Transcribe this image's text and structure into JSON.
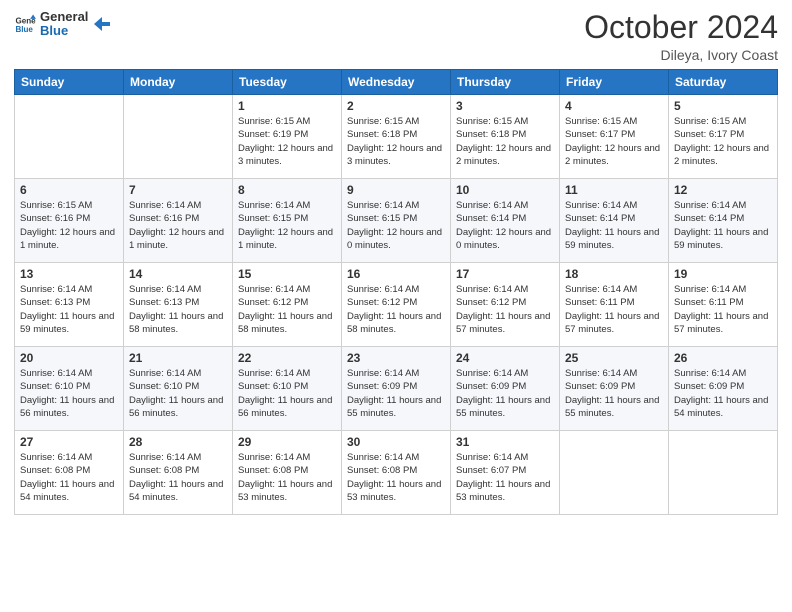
{
  "logo": {
    "line1": "General",
    "line2": "Blue"
  },
  "title": "October 2024",
  "subtitle": "Dileya, Ivory Coast",
  "days_header": [
    "Sunday",
    "Monday",
    "Tuesday",
    "Wednesday",
    "Thursday",
    "Friday",
    "Saturday"
  ],
  "weeks": [
    [
      {
        "day": "",
        "info": ""
      },
      {
        "day": "",
        "info": ""
      },
      {
        "day": "1",
        "info": "Sunrise: 6:15 AM\nSunset: 6:19 PM\nDaylight: 12 hours and 3 minutes."
      },
      {
        "day": "2",
        "info": "Sunrise: 6:15 AM\nSunset: 6:18 PM\nDaylight: 12 hours and 3 minutes."
      },
      {
        "day": "3",
        "info": "Sunrise: 6:15 AM\nSunset: 6:18 PM\nDaylight: 12 hours and 2 minutes."
      },
      {
        "day": "4",
        "info": "Sunrise: 6:15 AM\nSunset: 6:17 PM\nDaylight: 12 hours and 2 minutes."
      },
      {
        "day": "5",
        "info": "Sunrise: 6:15 AM\nSunset: 6:17 PM\nDaylight: 12 hours and 2 minutes."
      }
    ],
    [
      {
        "day": "6",
        "info": "Sunrise: 6:15 AM\nSunset: 6:16 PM\nDaylight: 12 hours and 1 minute."
      },
      {
        "day": "7",
        "info": "Sunrise: 6:14 AM\nSunset: 6:16 PM\nDaylight: 12 hours and 1 minute."
      },
      {
        "day": "8",
        "info": "Sunrise: 6:14 AM\nSunset: 6:15 PM\nDaylight: 12 hours and 1 minute."
      },
      {
        "day": "9",
        "info": "Sunrise: 6:14 AM\nSunset: 6:15 PM\nDaylight: 12 hours and 0 minutes."
      },
      {
        "day": "10",
        "info": "Sunrise: 6:14 AM\nSunset: 6:14 PM\nDaylight: 12 hours and 0 minutes."
      },
      {
        "day": "11",
        "info": "Sunrise: 6:14 AM\nSunset: 6:14 PM\nDaylight: 11 hours and 59 minutes."
      },
      {
        "day": "12",
        "info": "Sunrise: 6:14 AM\nSunset: 6:14 PM\nDaylight: 11 hours and 59 minutes."
      }
    ],
    [
      {
        "day": "13",
        "info": "Sunrise: 6:14 AM\nSunset: 6:13 PM\nDaylight: 11 hours and 59 minutes."
      },
      {
        "day": "14",
        "info": "Sunrise: 6:14 AM\nSunset: 6:13 PM\nDaylight: 11 hours and 58 minutes."
      },
      {
        "day": "15",
        "info": "Sunrise: 6:14 AM\nSunset: 6:12 PM\nDaylight: 11 hours and 58 minutes."
      },
      {
        "day": "16",
        "info": "Sunrise: 6:14 AM\nSunset: 6:12 PM\nDaylight: 11 hours and 58 minutes."
      },
      {
        "day": "17",
        "info": "Sunrise: 6:14 AM\nSunset: 6:12 PM\nDaylight: 11 hours and 57 minutes."
      },
      {
        "day": "18",
        "info": "Sunrise: 6:14 AM\nSunset: 6:11 PM\nDaylight: 11 hours and 57 minutes."
      },
      {
        "day": "19",
        "info": "Sunrise: 6:14 AM\nSunset: 6:11 PM\nDaylight: 11 hours and 57 minutes."
      }
    ],
    [
      {
        "day": "20",
        "info": "Sunrise: 6:14 AM\nSunset: 6:10 PM\nDaylight: 11 hours and 56 minutes."
      },
      {
        "day": "21",
        "info": "Sunrise: 6:14 AM\nSunset: 6:10 PM\nDaylight: 11 hours and 56 minutes."
      },
      {
        "day": "22",
        "info": "Sunrise: 6:14 AM\nSunset: 6:10 PM\nDaylight: 11 hours and 56 minutes."
      },
      {
        "day": "23",
        "info": "Sunrise: 6:14 AM\nSunset: 6:09 PM\nDaylight: 11 hours and 55 minutes."
      },
      {
        "day": "24",
        "info": "Sunrise: 6:14 AM\nSunset: 6:09 PM\nDaylight: 11 hours and 55 minutes."
      },
      {
        "day": "25",
        "info": "Sunrise: 6:14 AM\nSunset: 6:09 PM\nDaylight: 11 hours and 55 minutes."
      },
      {
        "day": "26",
        "info": "Sunrise: 6:14 AM\nSunset: 6:09 PM\nDaylight: 11 hours and 54 minutes."
      }
    ],
    [
      {
        "day": "27",
        "info": "Sunrise: 6:14 AM\nSunset: 6:08 PM\nDaylight: 11 hours and 54 minutes."
      },
      {
        "day": "28",
        "info": "Sunrise: 6:14 AM\nSunset: 6:08 PM\nDaylight: 11 hours and 54 minutes."
      },
      {
        "day": "29",
        "info": "Sunrise: 6:14 AM\nSunset: 6:08 PM\nDaylight: 11 hours and 53 minutes."
      },
      {
        "day": "30",
        "info": "Sunrise: 6:14 AM\nSunset: 6:08 PM\nDaylight: 11 hours and 53 minutes."
      },
      {
        "day": "31",
        "info": "Sunrise: 6:14 AM\nSunset: 6:07 PM\nDaylight: 11 hours and 53 minutes."
      },
      {
        "day": "",
        "info": ""
      },
      {
        "day": "",
        "info": ""
      }
    ]
  ]
}
